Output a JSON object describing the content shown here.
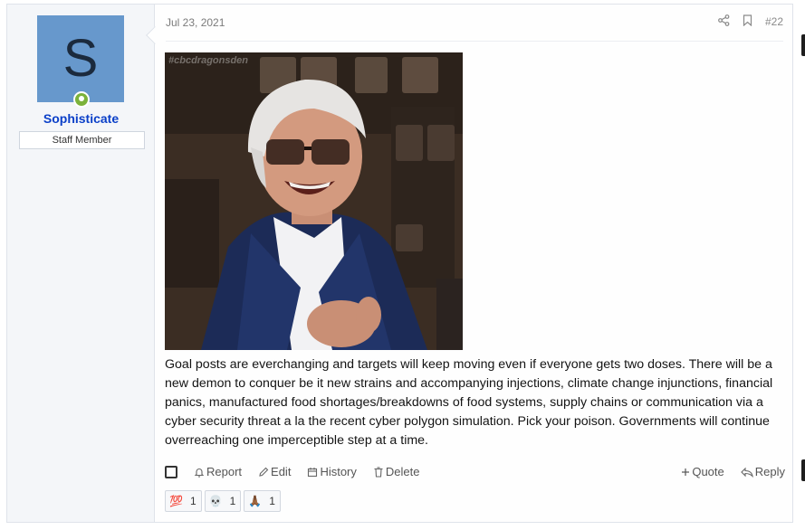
{
  "post": {
    "date": "Jul 23, 2021",
    "number": "#22",
    "body": "Goal posts are everchanging and targets will keep moving even if everyone gets two doses. There will be a new demon to conquer be it new strains and accompanying injections, climate change injunctions, financial panics, manufactured food shortages/breakdowns of food systems, supply chains or communication via a cyber security threat a la the recent cyber polygon simulation. Pick your poison. Governments will continue overreaching one imperceptible step at a time."
  },
  "user": {
    "avatar_letter": "S",
    "name": "Sophisticate",
    "title": "Staff Member",
    "avatar_color": "#6798cc",
    "online_color": "#7bb23a"
  },
  "image": {
    "watermark": "#cbcdragonsden"
  },
  "actions": {
    "report": "Report",
    "edit": "Edit",
    "history": "History",
    "delete": "Delete",
    "quote": "Quote",
    "reply": "Reply"
  },
  "reactions": [
    {
      "emoji": "💯",
      "count": "1"
    },
    {
      "emoji": "💀",
      "count": "1"
    },
    {
      "emoji": "🙏🏾",
      "count": "1"
    }
  ]
}
